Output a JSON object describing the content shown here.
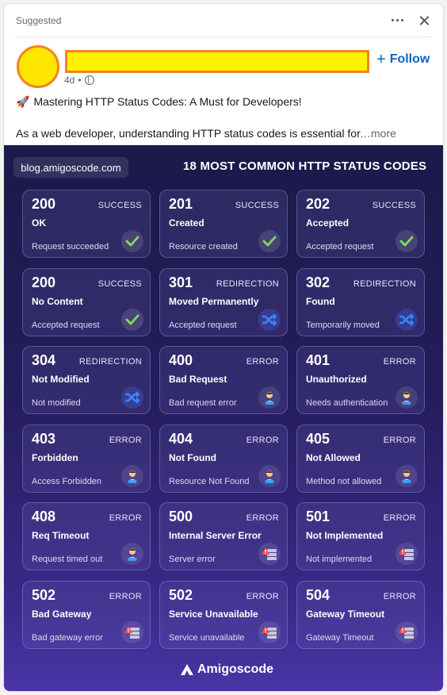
{
  "header": {
    "suggested": "Suggested"
  },
  "author": {
    "time": "4d",
    "separator": "•"
  },
  "follow_label": "Follow",
  "post": {
    "title": "Mastering HTTP Status Codes: A Must for Developers!",
    "body": "As a web developer, understanding HTTP status codes is essential for",
    "more": "…more"
  },
  "infographic": {
    "blog": "blog.amigoscode.com",
    "title": "18 MOST COMMON HTTP STATUS CODES",
    "brand": "Amigoscode",
    "tiles": [
      {
        "code": "200",
        "category": "SUCCESS",
        "name": "OK",
        "desc": "Request succeeded",
        "icon": "check-icon"
      },
      {
        "code": "201",
        "category": "SUCCESS",
        "name": "Created",
        "desc": "Resource created",
        "icon": "check-icon"
      },
      {
        "code": "202",
        "category": "SUCCESS",
        "name": "Accepted",
        "desc": "Accepted request",
        "icon": "check-icon"
      },
      {
        "code": "200",
        "category": "SUCCESS",
        "name": "No Content",
        "desc": "Accepted request",
        "icon": "check-icon"
      },
      {
        "code": "301",
        "category": "REDIRECTION",
        "name": "Moved Permanently",
        "desc": "Accepted request",
        "icon": "shuffle-icon"
      },
      {
        "code": "302",
        "category": "REDIRECTION",
        "name": "Found",
        "desc": "Temporarily moved",
        "icon": "shuffle-icon"
      },
      {
        "code": "304",
        "category": "REDIRECTION",
        "name": "Not Modified",
        "desc": "Not modified",
        "icon": "shuffle-icon"
      },
      {
        "code": "400",
        "category": "ERROR",
        "name": "Bad Request",
        "desc": "Bad request error",
        "icon": "client-icon"
      },
      {
        "code": "401",
        "category": "ERROR",
        "name": "Unauthorized",
        "desc": "Needs authentication",
        "icon": "client-icon"
      },
      {
        "code": "403",
        "category": "ERROR",
        "name": "Forbidden",
        "desc": "Access Forbidden",
        "icon": "client-icon"
      },
      {
        "code": "404",
        "category": "ERROR",
        "name": "Not Found",
        "desc": "Resource Not Found",
        "icon": "client-icon"
      },
      {
        "code": "405",
        "category": "ERROR",
        "name": "Not Allowed",
        "desc": "Method not allowed",
        "icon": "client-icon"
      },
      {
        "code": "408",
        "category": "ERROR",
        "name": "Req Timeout",
        "desc": "Request timed out",
        "icon": "client-icon"
      },
      {
        "code": "500",
        "category": "ERROR",
        "name": "Internal Server Error",
        "desc": "Server error",
        "icon": "server-error-icon"
      },
      {
        "code": "501",
        "category": "ERROR",
        "name": "Not Implemented",
        "desc": "Not implemented",
        "icon": "server-error-icon"
      },
      {
        "code": "502",
        "category": "ERROR",
        "name": "Bad Gateway",
        "desc": "Bad gateway error",
        "icon": "server-error-icon"
      },
      {
        "code": "502",
        "category": "ERROR",
        "name": "Service Unavailable",
        "desc": "Service unavailable",
        "icon": "server-error-icon"
      },
      {
        "code": "504",
        "category": "ERROR",
        "name": "Gateway Timeout",
        "desc": "Gateway Timeout",
        "icon": "server-error-icon"
      }
    ]
  },
  "colors": {
    "follow": "#0a66c2",
    "avatar_fill": "#ffe600",
    "redaction_fill": "#fff200",
    "redaction_border": "#f58220"
  }
}
